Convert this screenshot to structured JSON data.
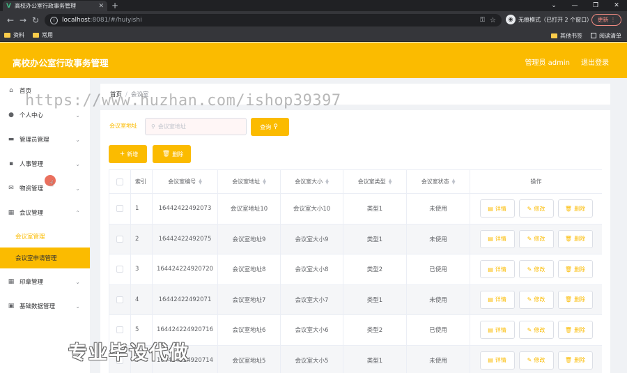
{
  "browser": {
    "tab_title": "高校办公室行政事务管理",
    "url_host": "localhost",
    "url_path": ":8081/#/huiyishi",
    "incognito_label": "无痕模式（已打开 2 个窗口）",
    "update_label": "更新",
    "bookmarks": [
      "资料",
      "常用"
    ],
    "bookmarks_right": [
      "其他书签",
      "阅读清单"
    ]
  },
  "header": {
    "title": "高校办公室行政事务管理",
    "user": "管理员 admin",
    "logout": "退出登录"
  },
  "sidebar": {
    "items": [
      {
        "label": "首页",
        "icon": "home-icon"
      },
      {
        "label": "个人中心",
        "icon": "user-icon"
      },
      {
        "label": "管理员管理",
        "icon": "admin-icon"
      },
      {
        "label": "人事管理",
        "icon": "personnel-icon"
      },
      {
        "label": "物资管理",
        "icon": "mail-icon"
      },
      {
        "label": "会议管理",
        "icon": "grid-icon"
      },
      {
        "label": "印章管理",
        "icon": "grid-icon"
      },
      {
        "label": "基础数据管理",
        "icon": "clipboard-icon"
      }
    ],
    "sub_items": [
      "会议室管理",
      "会议室申请管理"
    ]
  },
  "breadcrumb": {
    "home": "首页",
    "current": "会议室"
  },
  "search": {
    "label": "会议室地址",
    "placeholder": "会议室地址",
    "button": "查询"
  },
  "actions": {
    "add": "新增",
    "delete": "删除"
  },
  "table": {
    "headers": [
      "索引",
      "会议室编号",
      "会议室地址",
      "会议室大小",
      "会议室类型",
      "会议室状态",
      "操作"
    ],
    "op_labels": {
      "detail": "详情",
      "edit": "修改",
      "delete": "删除"
    },
    "rows": [
      {
        "index": "1",
        "code": "16442422492073",
        "address": "会议室地址10",
        "size": "会议室大小10",
        "type": "类型1",
        "status": "未使用"
      },
      {
        "index": "2",
        "code": "16442422492075",
        "address": "会议室地址9",
        "size": "会议室大小9",
        "type": "类型1",
        "status": "未使用"
      },
      {
        "index": "3",
        "code": "164424224920720",
        "address": "会议室地址8",
        "size": "会议室大小8",
        "type": "类型2",
        "status": "已使用"
      },
      {
        "index": "4",
        "code": "16442422492071",
        "address": "会议室地址7",
        "size": "会议室大小7",
        "type": "类型1",
        "status": "未使用"
      },
      {
        "index": "5",
        "code": "164424224920716",
        "address": "会议室地址6",
        "size": "会议室大小6",
        "type": "类型2",
        "status": "已使用"
      },
      {
        "index": "6",
        "code": "164424224920714",
        "address": "会议室地址5",
        "size": "会议室大小5",
        "type": "类型1",
        "status": "未使用"
      }
    ]
  },
  "watermark": "https://www.huzhan.com/ishop39397",
  "promo": "专业毕设代做",
  "colors": {
    "accent": "#fbbb00",
    "chrome_dark": "#35363a"
  }
}
